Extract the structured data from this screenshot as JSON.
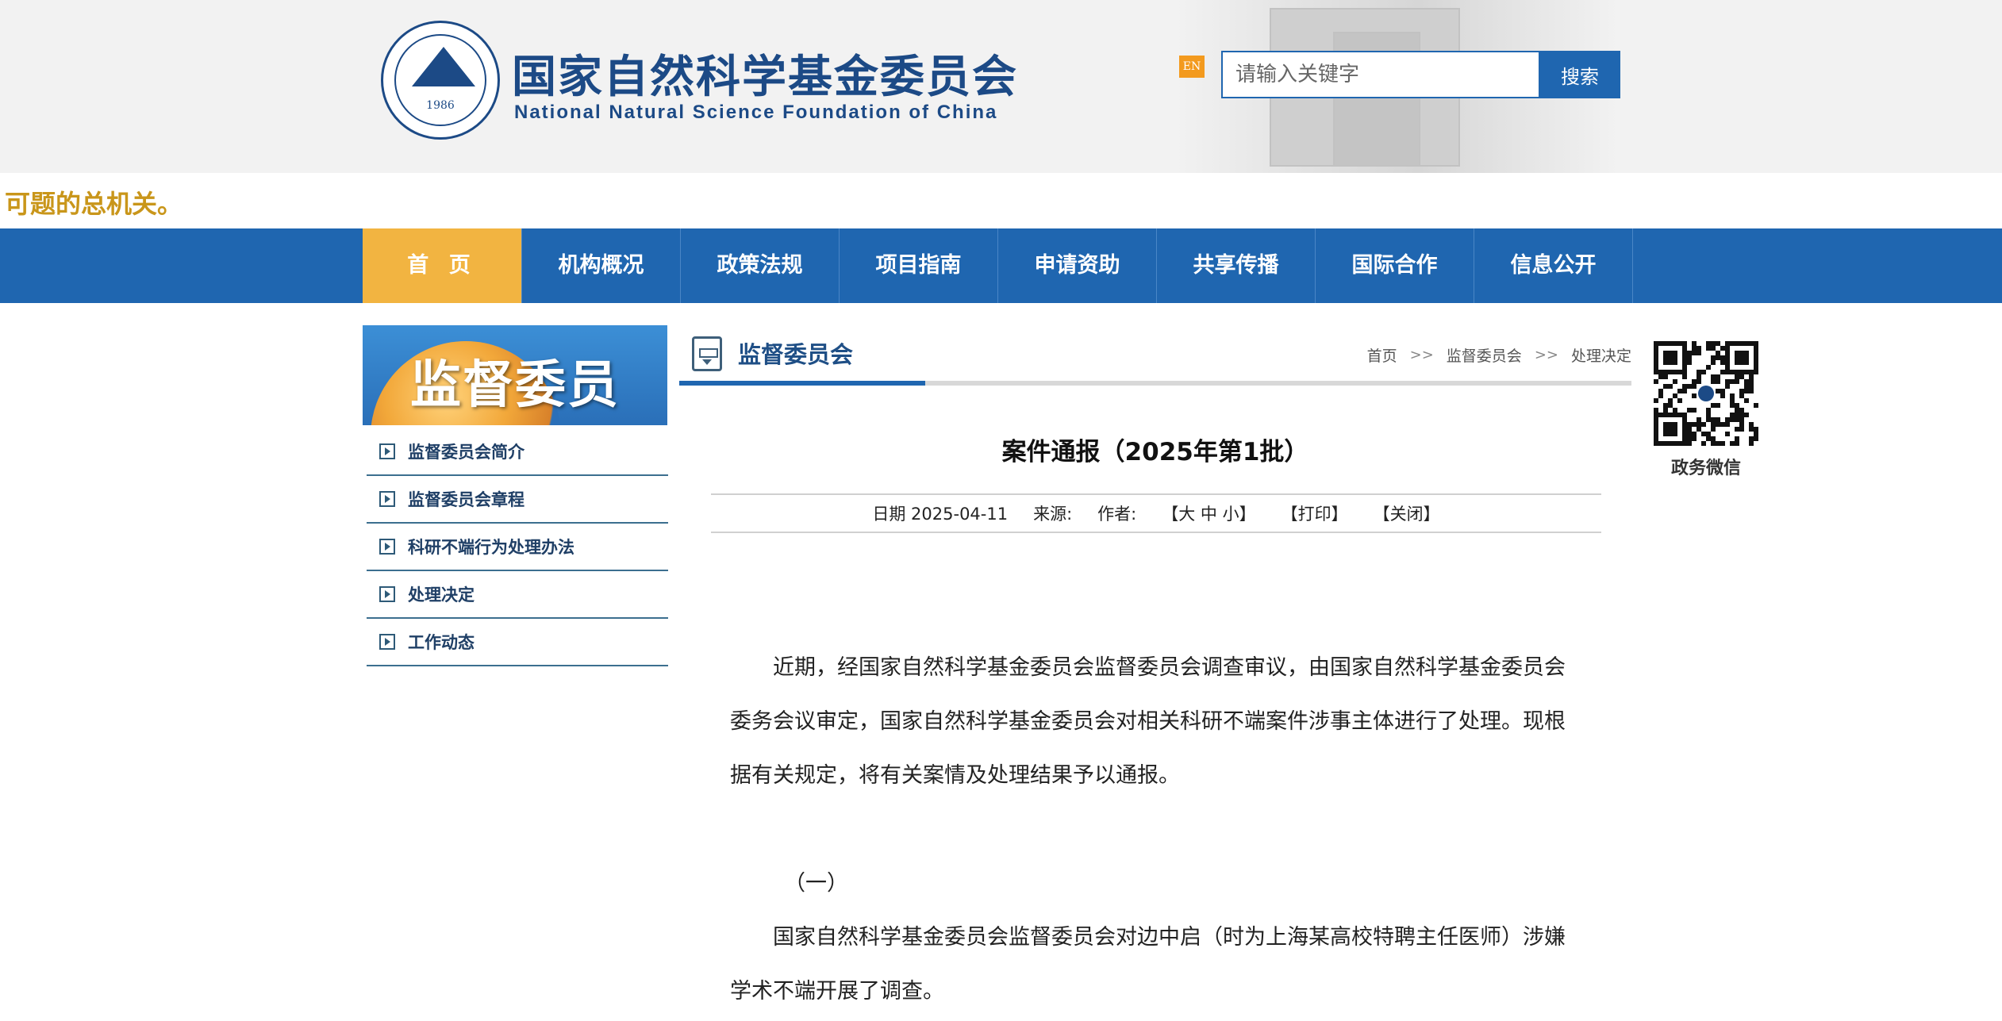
{
  "header": {
    "logo_cn": "国家自然科学基金委员会",
    "logo_en": "National Natural Science Foundation of China",
    "seal_year": "1986",
    "en_badge": "EN",
    "search_placeholder": "请输入关键字",
    "search_button": "搜索"
  },
  "marquee": {
    "text": "可题的总机关。"
  },
  "nav": {
    "items": [
      {
        "label": "首 页"
      },
      {
        "label": "机构概况"
      },
      {
        "label": "政策法规"
      },
      {
        "label": "项目指南"
      },
      {
        "label": "申请资助"
      },
      {
        "label": "共享传播"
      },
      {
        "label": "国际合作"
      },
      {
        "label": "信息公开"
      }
    ]
  },
  "sidebar": {
    "banner": "监督委员会",
    "items": [
      {
        "label": "监督委员会简介"
      },
      {
        "label": "监督委员会章程"
      },
      {
        "label": "科研不端行为处理办法"
      },
      {
        "label": "处理决定"
      },
      {
        "label": "工作动态"
      }
    ]
  },
  "column": {
    "title": "监督委员会",
    "breadcrumb": [
      "首页",
      "监督委员会",
      "处理决定"
    ],
    "breadcrumb_sep": ">>"
  },
  "article": {
    "title": "案件通报（2025年第1批）",
    "date": "日期 2025-04-11",
    "source": "来源:",
    "author": "作者:",
    "font_size": "【大 中 小】",
    "print": "【打印】",
    "close": "【关闭】",
    "para1": "近期，经国家自然科学基金委员会监督委员会调查审议，由国家自然科学基金委员会委务会议审定，国家自然科学基金委员会对相关科研不端案件涉事主体进行了处理。现根据有关规定，将有关案情及处理结果予以通报。",
    "section1": "（一）",
    "para2": "国家自然科学基金委员会监督委员会对边中启（时为上海某高校特聘主任医师）涉嫌学术不端开展了调查。"
  },
  "qr": {
    "label": "政务微信"
  }
}
